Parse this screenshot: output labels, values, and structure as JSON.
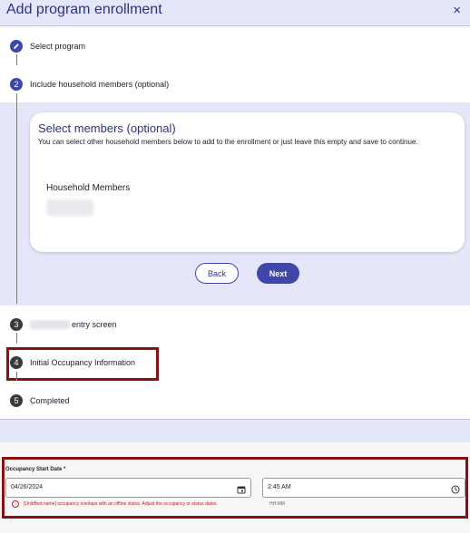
{
  "dialog": {
    "title": "Add program enrollment",
    "close_glyph": "×"
  },
  "steps": [
    {
      "number": "",
      "label": "Select program",
      "state": "completed",
      "icon": "pencil-icon"
    },
    {
      "number": "2",
      "label": "Include household members (optional)",
      "state": "active"
    },
    {
      "number": "3",
      "label": "entry screen",
      "state": "pending",
      "label_prefix_redacted": true
    },
    {
      "number": "4",
      "label": "Initial Occupancy Information",
      "state": "pending"
    },
    {
      "number": "5",
      "label": "Completed",
      "state": "pending"
    }
  ],
  "members_card": {
    "title": "Select members (optional)",
    "description": "You can select other household members below to add to the enrollment or just leave this empty and save to continue.",
    "household_label": "Household Members"
  },
  "buttons": {
    "back": "Back",
    "next": "Next"
  },
  "occupancy": {
    "start_date_label": "Occupancy Start Date *",
    "date_value": "04/26/2024",
    "time_value": "2:45 AM",
    "time_hint": "HH:MM",
    "error_text": "[Unit/Bed name] occupancy overlaps with an offline status. Adjust the occupancy or status dates."
  },
  "colors": {
    "accent": "#3f47a8",
    "panel": "#e5e6fa",
    "highlight": "#8a1111",
    "error": "#b3261e"
  }
}
